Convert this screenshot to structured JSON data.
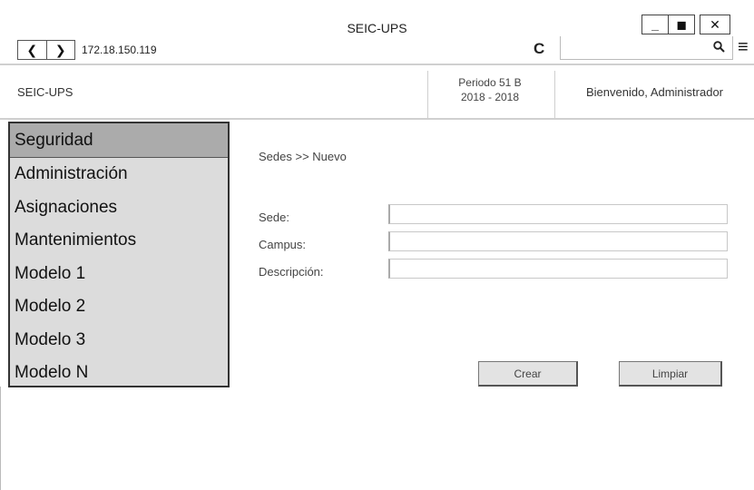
{
  "window": {
    "title": "SEIC-UPS",
    "minimize_glyph": "_",
    "restore_glyph": "◼",
    "close_glyph": "✕"
  },
  "browser": {
    "back_glyph": "❮",
    "forward_glyph": "❯",
    "url": "172.18.150.119",
    "reload_glyph": "C",
    "search_glyph": "⚲",
    "menu_glyph": "≡",
    "icons": [
      "back-icon",
      "forward-icon",
      "reload-icon",
      "search-icon",
      "hamburger-menu-icon"
    ]
  },
  "header": {
    "brand": "SEIC-UPS",
    "periodo_line1": "Periodo 51 B",
    "periodo_line2": "2018 - 2018",
    "welcome": "Bienvenido, Administrador"
  },
  "sidebar": {
    "items": [
      {
        "label": "Seguridad",
        "active": true
      },
      {
        "label": "Administración",
        "active": false
      },
      {
        "label": "Asignaciones",
        "active": false
      },
      {
        "label": "Mantenimientos",
        "active": false
      },
      {
        "label": "Modelo 1",
        "active": false
      },
      {
        "label": "Modelo 2",
        "active": false
      },
      {
        "label": "Modelo 3",
        "active": false
      },
      {
        "label": "Modelo N",
        "active": false
      }
    ]
  },
  "main": {
    "breadcrumb": "Sedes >> Nuevo",
    "form": {
      "sede_label": "Sede:",
      "sede_value": "",
      "campus_label": "Campus:",
      "campus_value": "",
      "descripcion_label": "Descripción:",
      "descripcion_value": ""
    },
    "buttons": {
      "crear": "Crear",
      "limpiar": "Limpiar"
    }
  },
  "colors": {
    "sidebar_bg": "#dcdcdc",
    "sidebar_active_bg": "#ababab",
    "button_bg": "#e3e3e3",
    "separator": "#d0d0d0"
  }
}
